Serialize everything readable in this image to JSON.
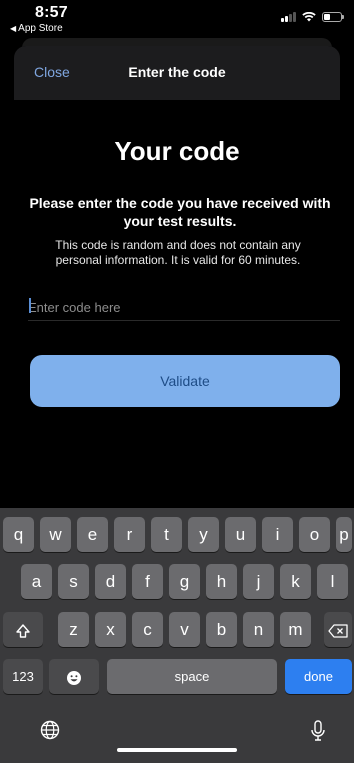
{
  "status_bar": {
    "time": "8:57",
    "back_app": "App Store"
  },
  "nav": {
    "close": "Close",
    "title": "Enter the code"
  },
  "content": {
    "heading": "Your code",
    "instruction": "Please enter the code you have received with your test results.",
    "info": "This code is random and does not contain any personal information. It is valid for 60 minutes.",
    "input_placeholder": "Enter code here",
    "input_value": "",
    "validate_label": "Validate"
  },
  "keyboard": {
    "row1": [
      "q",
      "w",
      "e",
      "r",
      "t",
      "y",
      "u",
      "i",
      "o",
      "p"
    ],
    "row2": [
      "a",
      "s",
      "d",
      "f",
      "g",
      "h",
      "j",
      "k",
      "l"
    ],
    "row3": [
      "z",
      "x",
      "c",
      "v",
      "b",
      "n",
      "m"
    ],
    "numbers_key": "123",
    "space_key": "space",
    "done_key": "done",
    "shift_icon": "shift-icon",
    "delete_icon": "backspace-icon",
    "emoji_icon": "emoji-icon",
    "globe_icon": "globe-icon",
    "mic_icon": "microphone-icon"
  },
  "colors": {
    "accent": "#7fb0ec",
    "accent_text": "#1e4c86",
    "link": "#7fa6e0",
    "done_key": "#2d7ff0"
  }
}
